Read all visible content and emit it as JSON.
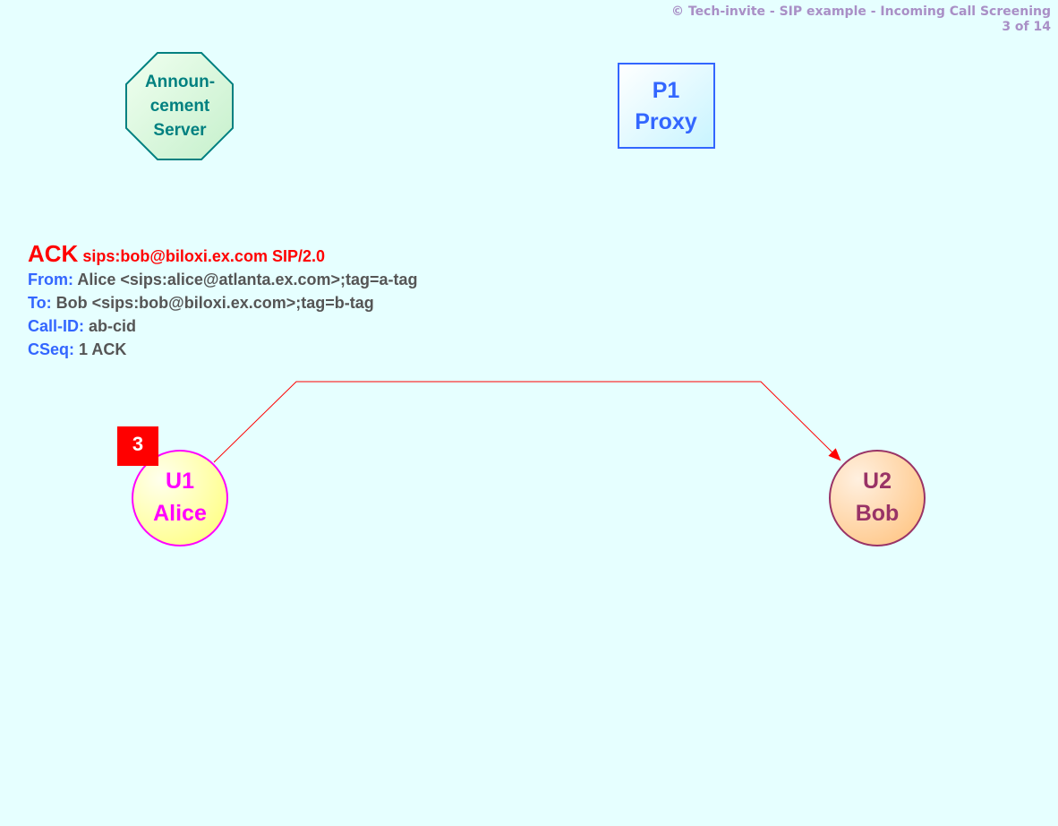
{
  "header": {
    "title": "© Tech-invite - SIP example - Incoming Call Screening",
    "page": "3 of 14"
  },
  "nodes": {
    "announcement_server": {
      "line1": "Announ-",
      "line2": "cement",
      "line3": "Server",
      "color": "#008080"
    },
    "p1_proxy": {
      "line1": "P1",
      "line2": "Proxy",
      "color": "#3366ff"
    },
    "u1_alice": {
      "line1": "U1",
      "line2": "Alice",
      "color": "#ff00ff"
    },
    "u2_bob": {
      "line1": "U2",
      "line2": "Bob",
      "color": "#993366"
    }
  },
  "step": {
    "number": "3",
    "from": "U1 Alice",
    "to": "U2 Bob",
    "arrow_color": "#ff0000"
  },
  "message": {
    "method": "ACK",
    "request_uri": "sips:bob@biloxi.ex.com SIP/2.0",
    "headers": [
      {
        "name": "From",
        "value": "Alice <sips:alice@atlanta.ex.com>;tag=a-tag"
      },
      {
        "name": "To",
        "value": "Bob <sips:bob@biloxi.ex.com>;tag=b-tag"
      },
      {
        "name": "Call-ID",
        "value": "ab-cid"
      },
      {
        "name": "CSeq",
        "value": "1 ACK"
      }
    ]
  }
}
